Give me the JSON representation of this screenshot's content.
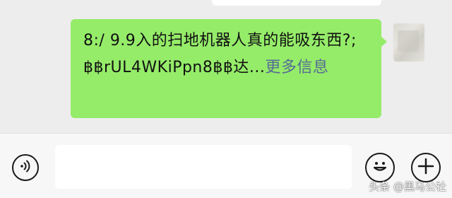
{
  "colors": {
    "background": "#ededed",
    "bubble": "#95ec69",
    "link": "#576b95",
    "input_bar": "#f7f7f7",
    "input_field": "#ffffff"
  },
  "message": {
    "text": "8:/ 9.9入的扫地机器人真的能吸东西?; ฿฿rUL4WKiPpn8฿฿达...",
    "more_label": "更多信息"
  },
  "input_bar": {
    "text_value": "",
    "icons": {
      "voice": "voice-icon",
      "emoji": "emoji-icon",
      "plus": "plus-icon"
    }
  },
  "watermark": {
    "text": "头条 @黑马公社"
  }
}
